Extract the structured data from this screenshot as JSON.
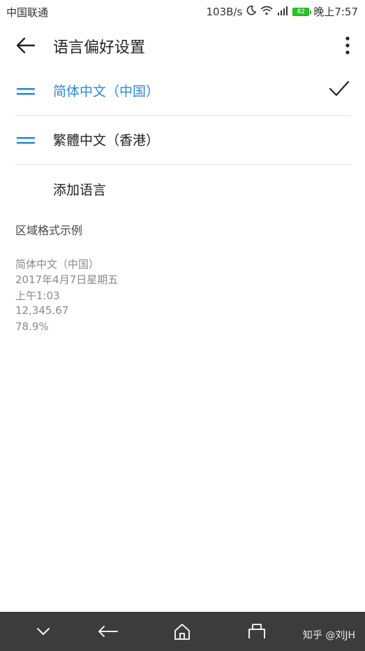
{
  "status": {
    "carrier": "中国联通",
    "speed": "103B/s",
    "battery": "82",
    "time": "晚上7:57"
  },
  "header": {
    "title": "语言偏好设置"
  },
  "languages": [
    {
      "label": "简体中文（中国）",
      "selected": true
    },
    {
      "label": "繁體中文（香港）",
      "selected": false
    }
  ],
  "add_language": "添加语言",
  "region_section": {
    "title": "区域格式示例",
    "samples": [
      "简体中文（中国）",
      "2017年4月7日星期五",
      "上午1:03",
      "12,345.67",
      "78.9%"
    ]
  },
  "watermark": "知乎 @刘JH",
  "colors": {
    "accent": "#2a8ad8",
    "navbar": "#3c3c3c"
  }
}
